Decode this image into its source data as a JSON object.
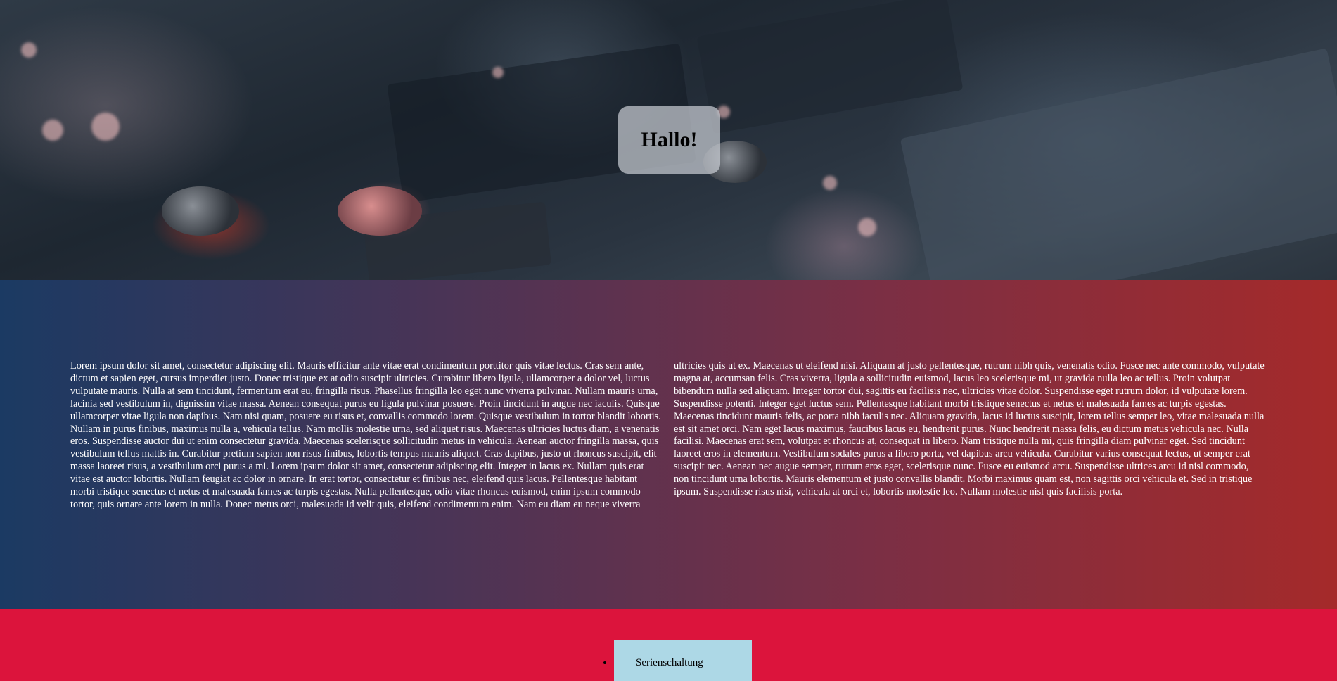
{
  "hero": {
    "greeting": "Hallo!"
  },
  "main": {
    "paragraph": "Lorem ipsum dolor sit amet, consectetur adipiscing elit. Mauris efficitur ante vitae erat condimentum porttitor quis vitae lectus. Cras sem ante, dictum et sapien eget, cursus imperdiet justo. Donec tristique ex at odio suscipit ultricies. Curabitur libero ligula, ullamcorper a dolor vel, luctus vulputate mauris. Nulla at sem tincidunt, fermentum erat eu, fringilla risus. Phasellus fringilla leo eget nunc viverra pulvinar. Nullam mauris urna, lacinia sed vestibulum in, dignissim vitae massa. Aenean consequat purus eu ligula pulvinar posuere. Proin tincidunt in augue nec iaculis. Quisque ullamcorper vitae ligula non dapibus. Nam nisi quam, posuere eu risus et, convallis commodo lorem. Quisque vestibulum in tortor blandit lobortis. Nullam in purus finibus, maximus nulla a, vehicula tellus. Nam mollis molestie urna, sed aliquet risus. Maecenas ultricies luctus diam, a venenatis eros. Suspendisse auctor dui ut enim consectetur gravida. Maecenas scelerisque sollicitudin metus in vehicula. Aenean auctor fringilla massa, quis vestibulum tellus mattis in. Curabitur pretium sapien non risus finibus, lobortis tempus mauris aliquet. Cras dapibus, justo ut rhoncus suscipit, elit massa laoreet risus, a vestibulum orci purus a mi. Lorem ipsum dolor sit amet, consectetur adipiscing elit. Integer in lacus ex. Nullam quis erat vitae est auctor lobortis. Nullam feugiat ac dolor in ornare. In erat tortor, consectetur et finibus nec, eleifend quis lacus. Pellentesque habitant morbi tristique senectus et netus et malesuada fames ac turpis egestas. Nulla pellentesque, odio vitae rhoncus euismod, enim ipsum commodo tortor, quis ornare ante lorem in nulla. Donec metus orci, malesuada id velit quis, eleifend condimentum enim. Nam eu diam eu neque viverra ultricies quis ut ex. Maecenas ut eleifend nisi. Aliquam at justo pellentesque, rutrum nibh quis, venenatis odio. Fusce nec ante commodo, vulputate magna at, accumsan felis. Cras viverra, ligula a sollicitudin euismod, lacus leo scelerisque mi, ut gravida nulla leo ac tellus. Proin volutpat bibendum nulla sed aliquam. Integer tortor dui, sagittis eu facilisis nec, ultricies vitae dolor. Suspendisse eget rutrum dolor, id vulputate lorem. Suspendisse potenti. Integer eget luctus sem. Pellentesque habitant morbi tristique senectus et netus et malesuada fames ac turpis egestas. Maecenas tincidunt mauris felis, ac porta nibh iaculis nec. Aliquam gravida, lacus id luctus suscipit, lorem tellus semper leo, vitae malesuada nulla est sit amet orci. Nam eget lacus maximus, faucibus lacus eu, hendrerit purus. Nunc hendrerit massa felis, eu dictum metus vehicula nec. Nulla facilisi. Maecenas erat sem, volutpat et rhoncus at, consequat in libero. Nam tristique nulla mi, quis fringilla diam pulvinar eget. Sed tincidunt laoreet eros in elementum. Vestibulum sodales purus a libero porta, vel dapibus arcu vehicula. Curabitur varius consequat lectus, ut semper erat suscipit nec. Aenean nec augue semper, rutrum eros eget, scelerisque nunc. Fusce eu euismod arcu. Suspendisse ultrices arcu id nisl commodo, non tincidunt urna lobortis. Mauris elementum et justo convallis blandit. Morbi maximus quam est, non sagittis orci vehicula et. Sed in tristique ipsum. Suspendisse risus nisi, vehicula at orci et, lobortis molestie leo. Nullam molestie nisl quis facilisis porta."
  },
  "nav": {
    "items": [
      {
        "label": "Serienschaltung"
      }
    ]
  }
}
